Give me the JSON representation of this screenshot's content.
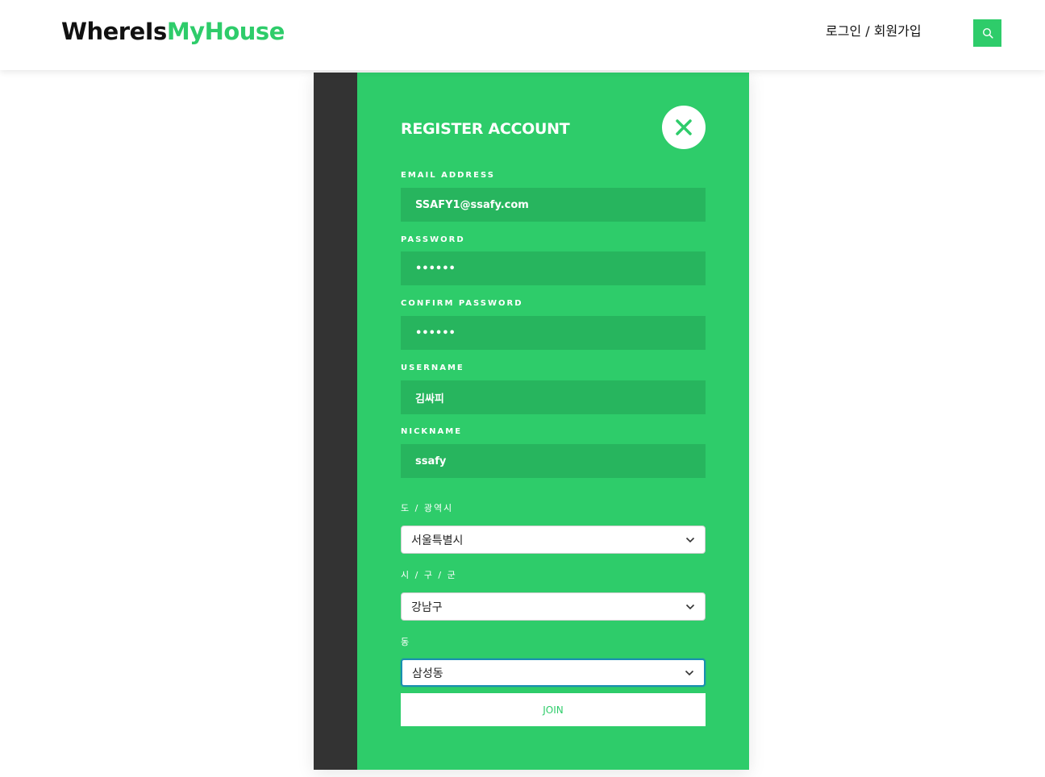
{
  "header": {
    "logo_part1": "WhereIs",
    "logo_part2": "MyHouse",
    "auth_link": "로그인 / 회원가입",
    "search_icon": "search-icon"
  },
  "modal": {
    "title": "REGISTER ACCOUNT",
    "close_icon": "close-icon",
    "fields": {
      "email_label": "EMAIL ADDRESS",
      "email_value": "SSAFY1@ssafy.com",
      "password_label": "PASSWORD",
      "password_value": "••••••",
      "confirm_label": "CONFIRM PASSWORD",
      "confirm_value": "••••••",
      "username_label": "USERNAME",
      "username_value": "김싸피",
      "nickname_label": "NICKNAME",
      "nickname_value": "ssafy"
    },
    "region": {
      "province_label": "도 / 광역시",
      "province_value": "서울특별시",
      "city_label": "시 / 구 / 군",
      "city_value": "강남구",
      "dong_label": "동",
      "dong_value": "삼성동"
    },
    "join_label": "JOIN"
  },
  "colors": {
    "accent": "#2ecc6a",
    "input_bg": "#27b55e",
    "strip": "#333333"
  }
}
